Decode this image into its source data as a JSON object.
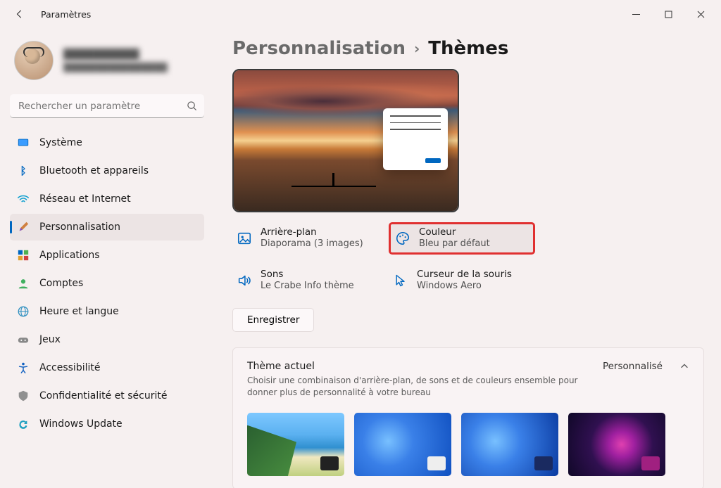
{
  "app": {
    "title": "Paramètres"
  },
  "user": {
    "name": "██████████",
    "email": "████████████████"
  },
  "search": {
    "placeholder": "Rechercher un paramètre"
  },
  "sidebar": {
    "items": [
      {
        "label": "Système"
      },
      {
        "label": "Bluetooth et appareils"
      },
      {
        "label": "Réseau et Internet"
      },
      {
        "label": "Personnalisation"
      },
      {
        "label": "Applications"
      },
      {
        "label": "Comptes"
      },
      {
        "label": "Heure et langue"
      },
      {
        "label": "Jeux"
      },
      {
        "label": "Accessibilité"
      },
      {
        "label": "Confidentialité et sécurité"
      },
      {
        "label": "Windows Update"
      }
    ]
  },
  "crumb": {
    "parent": "Personnalisation",
    "current": "Thèmes"
  },
  "tiles": {
    "background": {
      "title": "Arrière-plan",
      "sub": "Diaporama (3 images)"
    },
    "color": {
      "title": "Couleur",
      "sub": "Bleu par défaut"
    },
    "sounds": {
      "title": "Sons",
      "sub": "Le Crabe Info thème"
    },
    "cursor": {
      "title": "Curseur de la souris",
      "sub": "Windows Aero"
    }
  },
  "save_label": "Enregistrer",
  "themes": {
    "title": "Thème actuel",
    "desc": "Choisir une combinaison d'arrière-plan, de sons et de couleurs ensemble pour donner plus de personnalité à votre bureau",
    "value": "Personnalisé"
  }
}
